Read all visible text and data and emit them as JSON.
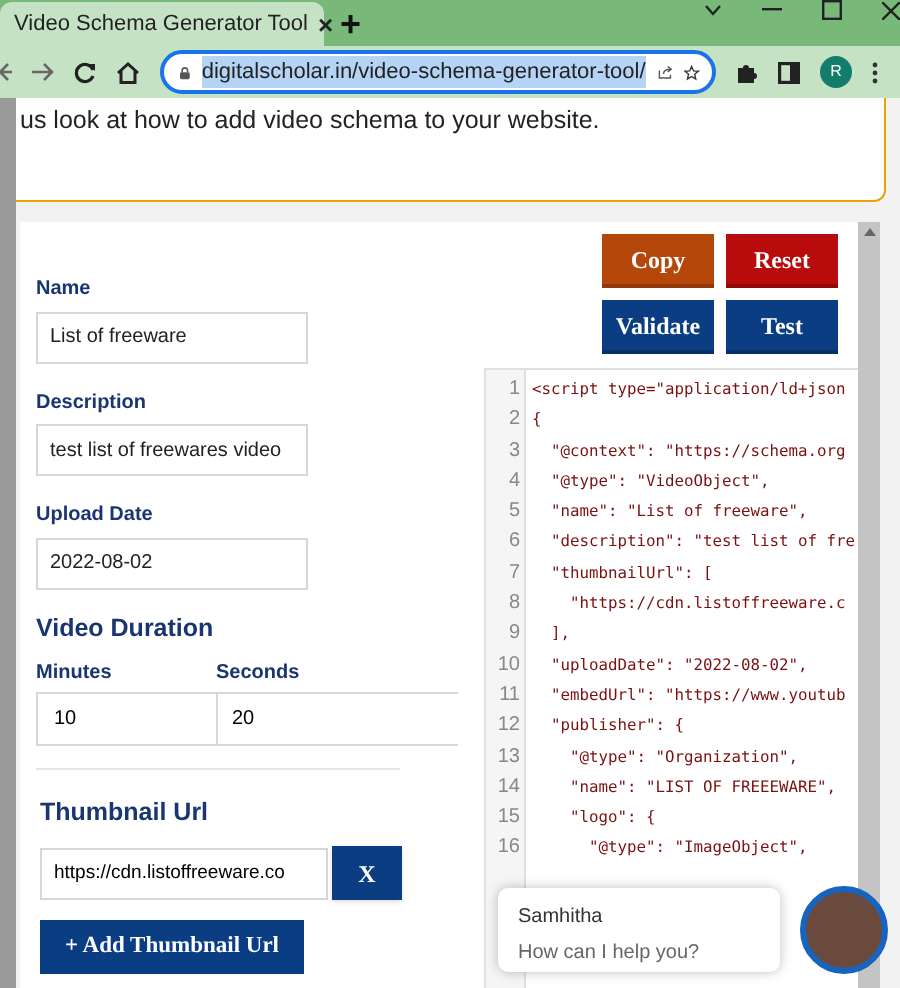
{
  "browser": {
    "tab": {
      "title": "Video Schema Generator Tool",
      "close": "×"
    },
    "new_tab": "+",
    "url": "digitalscholar.in/video-schema-generator-tool/",
    "profile": "R"
  },
  "intro": "us look at how to add video schema to your website.",
  "fields": [
    {
      "label": "Name",
      "value": "List of freeware"
    },
    {
      "label": "Description",
      "value": "test list of freewares video"
    },
    {
      "label": "Upload Date",
      "value": "2022-08-02"
    }
  ],
  "duration": {
    "title": "Video Duration",
    "minutes_label": "Minutes",
    "minutes": "10",
    "seconds_label": "Seconds",
    "seconds": "20"
  },
  "thumbnail": {
    "title": "Thumbnail Url",
    "value": "https://cdn.listoffreeware.co",
    "remove": "X",
    "add": "+ Add Thumbnail Url"
  },
  "buttons": [
    {
      "label": "Copy",
      "color": "#b5470b"
    },
    {
      "label": "Reset",
      "color": "#b80b0b"
    },
    {
      "label": "Validate",
      "color": "#0b3d82"
    },
    {
      "label": "Test",
      "color": "#0b3d82"
    }
  ],
  "code": {
    "lines": [
      {
        "number": "1",
        "text": "<script type=\"application/ld+json"
      },
      {
        "number": "2",
        "text": "{"
      },
      {
        "number": "3",
        "text": "  \"@context\": \"https://schema.org"
      },
      {
        "number": "4",
        "text": "  \"@type\": \"VideoObject\","
      },
      {
        "number": "5",
        "text": "  \"name\": \"List of freeware\","
      },
      {
        "number": "6",
        "text": "  \"description\": \"test list of fre"
      },
      {
        "number": "7",
        "text": "  \"thumbnailUrl\": ["
      },
      {
        "number": "8",
        "text": "    \"https://cdn.listoffreeware.c"
      },
      {
        "number": "9",
        "text": "  ],"
      },
      {
        "number": "10",
        "text": "  \"uploadDate\": \"2022-08-02\","
      },
      {
        "number": "11",
        "text": "  \"embedUrl\": \"https://www.youtub"
      },
      {
        "number": "12",
        "text": "  \"publisher\": {"
      },
      {
        "number": "13",
        "text": "    \"@type\": \"Organization\","
      },
      {
        "number": "14",
        "text": "    \"name\": \"LIST OF FREEEWARE\","
      },
      {
        "number": "15",
        "text": "    \"logo\": {"
      },
      {
        "number": "16",
        "text": "      \"@type\": \"ImageObject\","
      }
    ]
  },
  "chat": {
    "name": "Samhitha",
    "message": "How can I help you?"
  }
}
